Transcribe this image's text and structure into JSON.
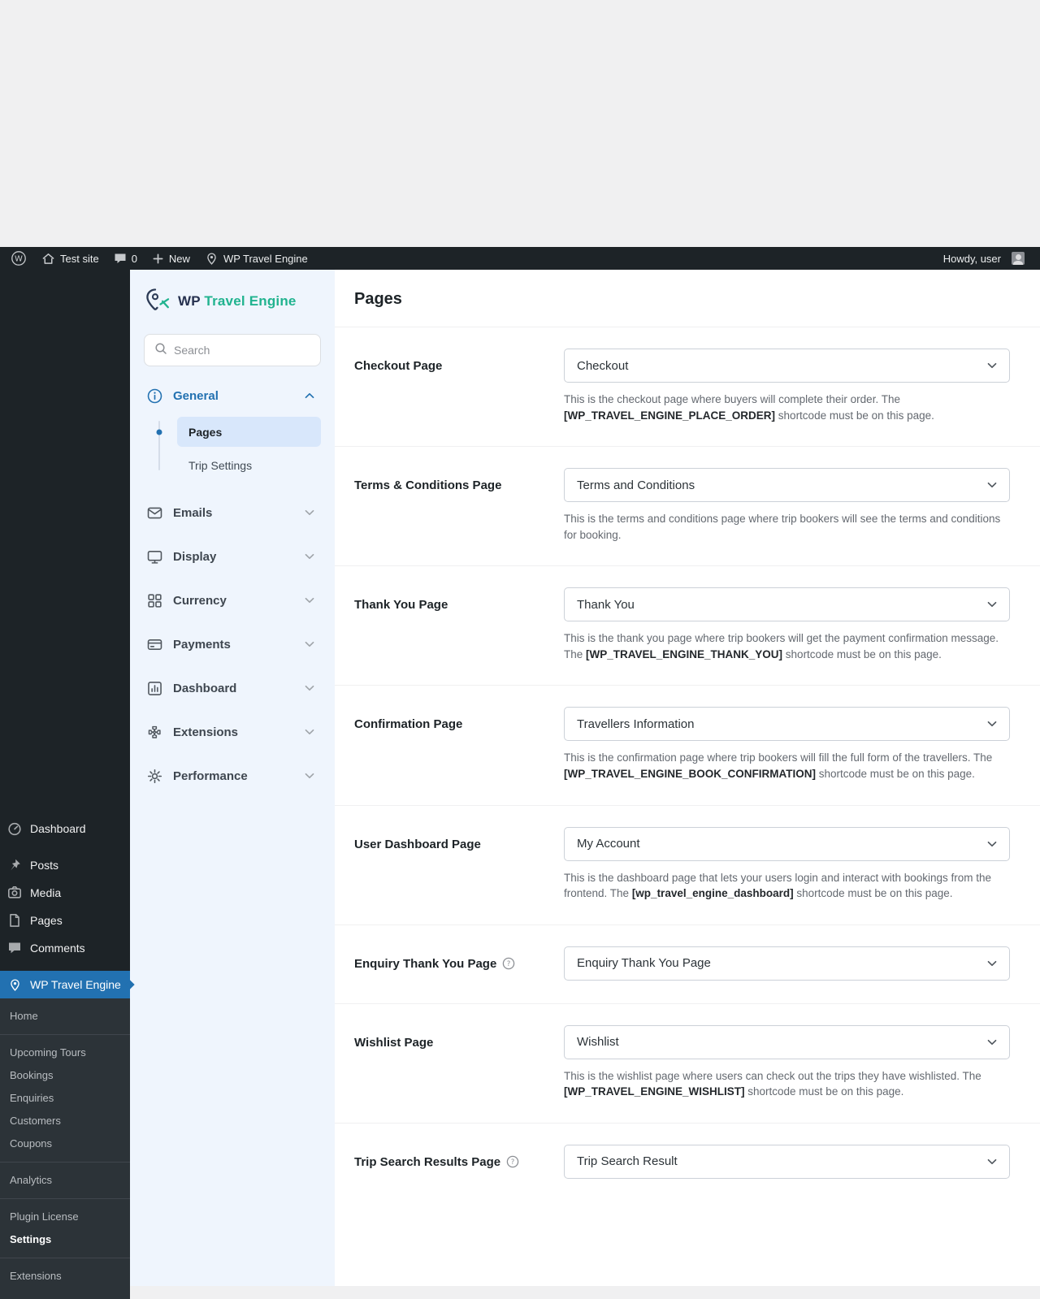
{
  "admin_bar": {
    "items": [
      {
        "icon": "wp-logo",
        "label": ""
      },
      {
        "icon": "home",
        "label": "Test site"
      },
      {
        "icon": "comment",
        "label": "0"
      },
      {
        "icon": "plus",
        "label": "New"
      },
      {
        "icon": "wpte-pin",
        "label": "WP Travel Engine"
      }
    ],
    "howdy_label": "Howdy, user"
  },
  "wp_sidebar": {
    "items": [
      {
        "label": "Dashboard",
        "icon": "dashboard",
        "separator_after": true
      },
      {
        "label": "Posts",
        "icon": "pin"
      },
      {
        "label": "Media",
        "icon": "media"
      },
      {
        "label": "Pages",
        "icon": "pages"
      },
      {
        "label": "Comments",
        "icon": "comments",
        "separator_after": true
      },
      {
        "label": "WP Travel Engine",
        "icon": "wpte-pin",
        "active": true
      }
    ],
    "submenu_groups": [
      {
        "items": [
          "Home"
        ]
      },
      {
        "items": [
          "Upcoming Tours",
          "Bookings",
          "Enquiries",
          "Customers",
          "Coupons"
        ]
      },
      {
        "items": [
          "Analytics"
        ]
      },
      {
        "items": [
          "Plugin License",
          "Settings"
        ]
      },
      {
        "items": [
          "Extensions"
        ]
      }
    ],
    "current_submenu": "Settings"
  },
  "plugin_sidebar": {
    "brand_prefix": "WP",
    "brand_suffix": "Travel Engine",
    "logo_icon": "wpte-logo",
    "search_placeholder": "Search",
    "menu": [
      {
        "label": "General",
        "icon": "info",
        "expanded": true,
        "children": [
          {
            "label": "Pages",
            "active": true
          },
          {
            "label": "Trip Settings"
          }
        ]
      },
      {
        "label": "Emails",
        "icon": "mail"
      },
      {
        "label": "Display",
        "icon": "display"
      },
      {
        "label": "Currency",
        "icon": "grid"
      },
      {
        "label": "Payments",
        "icon": "payments"
      },
      {
        "label": "Dashboard",
        "icon": "chart"
      },
      {
        "label": "Extensions",
        "icon": "puzzle"
      },
      {
        "label": "Performance",
        "icon": "gear"
      }
    ]
  },
  "main": {
    "title": "Pages",
    "settings": [
      {
        "label": "Checkout Page",
        "value": "Checkout",
        "desc_before": "This is the checkout page where buyers will complete their order. The",
        "shortcode": "[WP_TRAVEL_ENGINE_PLACE_ORDER]",
        "desc_after": "shortcode must be on this page."
      },
      {
        "label": "Terms & Conditions Page",
        "value": "Terms and Conditions",
        "desc_before": "This is the terms and conditions page where trip bookers will see the terms and conditions for booking.",
        "shortcode": "",
        "desc_after": ""
      },
      {
        "label": "Thank You Page",
        "value": "Thank You",
        "desc_before": "This is the thank you page where trip bookers will get the payment confirmation message. The",
        "shortcode": "[WP_TRAVEL_ENGINE_THANK_YOU]",
        "desc_after": "shortcode must be on this page."
      },
      {
        "label": "Confirmation Page",
        "value": "Travellers Information",
        "desc_before": "This is the confirmation page where trip bookers will fill the full form of the travellers. The",
        "shortcode": "[WP_TRAVEL_ENGINE_BOOK_CONFIRMATION]",
        "desc_after": "shortcode must be on this page."
      },
      {
        "label": "User Dashboard Page",
        "value": "My Account",
        "desc_before": "This is the dashboard page that lets your users login and interact with bookings from the frontend. The",
        "shortcode": "[wp_travel_engine_dashboard]",
        "desc_after": "shortcode must be on this page."
      },
      {
        "label": "Enquiry Thank You Page",
        "value": "Enquiry Thank You Page",
        "help": true
      },
      {
        "label": "Wishlist Page",
        "value": "Wishlist",
        "desc_before": "This is the wishlist page where users can check out the trips they have wishlisted. The",
        "shortcode": "[WP_TRAVEL_ENGINE_WISHLIST]",
        "desc_after": "shortcode must be on this page."
      },
      {
        "label": "Trip Search Results Page",
        "value": "Trip Search Result",
        "help": true
      }
    ]
  }
}
